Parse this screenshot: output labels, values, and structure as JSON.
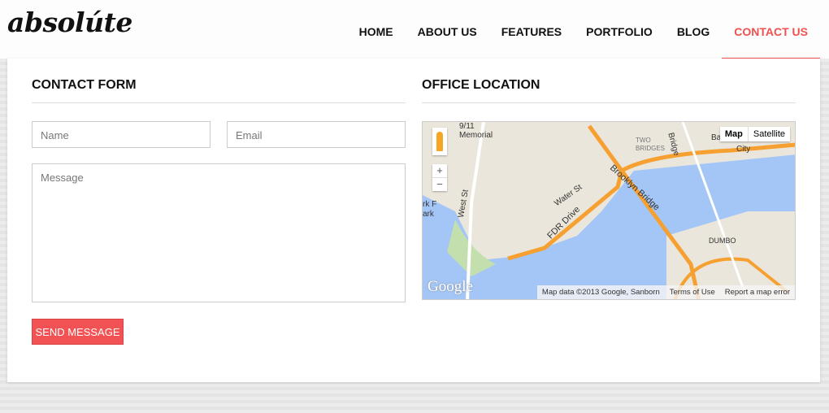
{
  "header": {
    "logo": "absolúte",
    "nav": [
      "HOME",
      "ABOUT US",
      "FEATURES",
      "PORTFOLIO",
      "BLOG",
      "CONTACT US"
    ],
    "active": "CONTACT US"
  },
  "contact": {
    "title": "CONTACT FORM",
    "name_placeholder": "Name",
    "email_placeholder": "Email",
    "message_placeholder": "Message",
    "submit": "SEND MESSAGE"
  },
  "office": {
    "title": "OFFICE LOCATION"
  },
  "map": {
    "type_map": "Map",
    "type_satellite": "Satellite",
    "zoom_in": "+",
    "zoom_out": "−",
    "google": "Google",
    "attribution": "Map data ©2013 Google, Sanborn",
    "terms": "Terms of Use",
    "report": "Report a map error",
    "labels": {
      "memorial": "9/11\nMemorial",
      "two_bridges": "TWO\nBRIDGES",
      "bridge": "Bridge",
      "city": "City",
      "brooklyn_bridge": "Brooklyn Bridge",
      "water_st": "Water St",
      "fdr": "FDR Drive",
      "west_st": "West St",
      "dumbo": "DUMBO",
      "park": "rk F\nark",
      "ba": "Ba"
    }
  },
  "colors": {
    "accent": "#f0504f",
    "water": "#a3c6f7",
    "highway": "#f5a030"
  }
}
